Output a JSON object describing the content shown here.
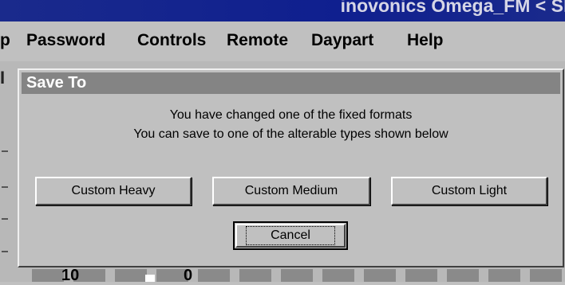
{
  "app": {
    "title": "inovonics Omega_FM < Sh",
    "menu": [
      "p",
      "Password",
      "Controls",
      "Remote",
      "Daypart",
      "Help"
    ],
    "left_label": "I",
    "bottom_values": [
      "10",
      "0"
    ]
  },
  "dialog": {
    "title": "Save To",
    "message_line1": "You have changed one of the fixed formats",
    "message_line2": "You can save to one of the alterable types shown below",
    "buttons": {
      "custom_heavy": "Custom Heavy",
      "custom_medium": "Custom Medium",
      "custom_light": "Custom Light",
      "cancel": "Cancel"
    }
  }
}
